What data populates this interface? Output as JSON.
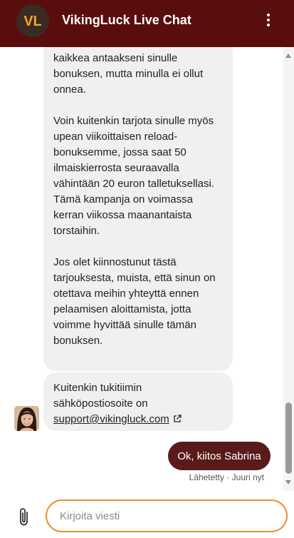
{
  "header": {
    "title": "VikingLuck Live Chat",
    "logo_text": "VL",
    "menu_icon": "more-vertical-icon"
  },
  "messages": {
    "agent_message_1": {
      "paragraphs": [
        "kaikkea antaakseni sinulle bonuksen, mutta minulla ei ollut onnea.",
        "Voin kuitenkin tarjota sinulle myös upean viikoittaisen reload-bonuksemme, jossa saat 50 ilmaiskierrosta seuraavalla vähintään 20 euron talletuksellasi. Tämä kampanja on voimassa kerran viikossa maanantaista torstaihin.",
        "Jos olet kiinnostunut tästä tarjouksesta, muista, että sinun on otettava meihin yhteyttä ennen pelaamisen aloittamista, jotta voimme hyvittää sinulle tämän bonuksen."
      ]
    },
    "agent_message_2": {
      "text": "Kuitenkin tukitiimin sähköpostiosoite on",
      "link": "support@vikingluck.com"
    },
    "user_message": {
      "text": "Ok, kiitos Sabrina",
      "status": "Lähetetty · Juuri nyt"
    }
  },
  "composer": {
    "placeholder": "Kirjoita viesti",
    "attach_icon": "paperclip-icon"
  },
  "colors": {
    "header_bg": "#5a0d0d",
    "logo_orange": "#f5a623",
    "user_bubble": "#5a1a1a",
    "agent_bubble": "#f0f0f0",
    "input_border": "#e8902e"
  }
}
